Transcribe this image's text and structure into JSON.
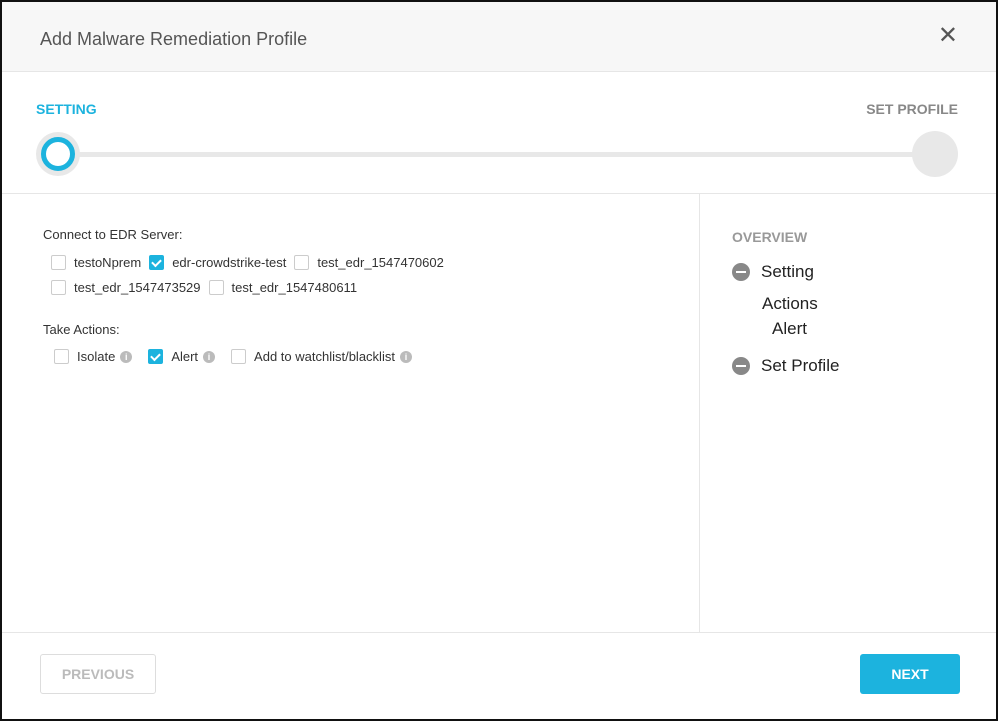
{
  "dialog": {
    "title": "Add Malware Remediation Profile",
    "close_icon": "close-icon"
  },
  "stepper": {
    "steps": [
      {
        "label": "SETTING",
        "active": true
      },
      {
        "label": "SET PROFILE",
        "active": false
      }
    ]
  },
  "accent_color": "#1cb3de",
  "edr": {
    "label": "Connect to EDR Server:",
    "servers": [
      {
        "name": "testoNprem",
        "checked": false
      },
      {
        "name": "edr-crowdstrike-test",
        "checked": true
      },
      {
        "name": "test_edr_1547470602",
        "checked": false
      },
      {
        "name": "test_edr_1547473529",
        "checked": false
      },
      {
        "name": "test_edr_1547480611",
        "checked": false
      }
    ]
  },
  "actions": {
    "label": "Take Actions:",
    "items": [
      {
        "name": "Isolate",
        "checked": false
      },
      {
        "name": "Alert",
        "checked": true
      },
      {
        "name": "Add to watchlist/blacklist",
        "checked": false
      }
    ]
  },
  "overview": {
    "title": "OVERVIEW",
    "setting": "Setting",
    "actions": "Actions",
    "alert": "Alert",
    "set_profile": "Set Profile"
  },
  "footer": {
    "previous": "PREVIOUS",
    "next": "NEXT"
  }
}
